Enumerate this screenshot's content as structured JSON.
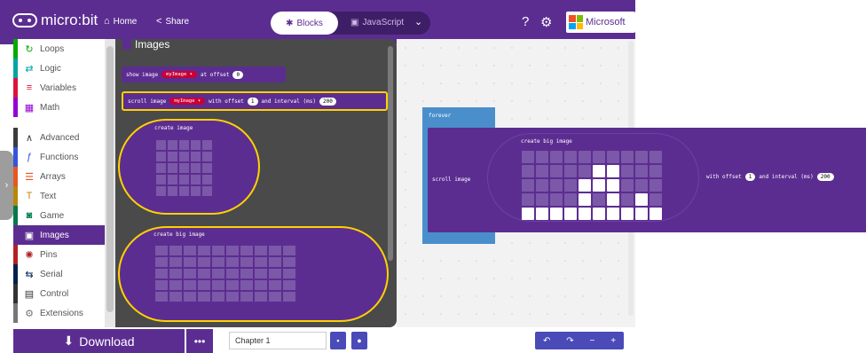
{
  "header": {
    "logo_text": "micro:bit",
    "home_label": "Home",
    "share_label": "Share",
    "blocks_label": "Blocks",
    "javascript_label": "JavaScript",
    "brand_label": "Microsoft",
    "icons": [
      "home-icon",
      "share-icon",
      "help-icon",
      "gear-icon"
    ]
  },
  "toolbox": {
    "categories": [
      {
        "label": "Loops",
        "color": "#00aa00",
        "icon": "loop-icon"
      },
      {
        "label": "Logic",
        "color": "#00a4a6",
        "icon": "logic-icon"
      },
      {
        "label": "Variables",
        "color": "#dc143c",
        "icon": "variables-icon"
      },
      {
        "label": "Math",
        "color": "#9400d3",
        "icon": "math-icon"
      },
      {
        "label": "Advanced",
        "color": "#3c3c3c",
        "icon": "chevron-up-icon"
      },
      {
        "label": "Functions",
        "color": "#3455db",
        "icon": "functions-icon"
      },
      {
        "label": "Arrays",
        "color": "#e65722",
        "icon": "arrays-icon"
      },
      {
        "label": "Text",
        "color": "#b8860b",
        "icon": "text-icon"
      },
      {
        "label": "Game",
        "color": "#007a4b",
        "icon": "game-icon"
      },
      {
        "label": "Images",
        "color": "#5c2d91",
        "icon": "images-icon"
      },
      {
        "label": "Pins",
        "color": "#b22222",
        "icon": "pins-icon"
      },
      {
        "label": "Serial",
        "color": "#002050",
        "icon": "serial-icon"
      },
      {
        "label": "Control",
        "color": "#333333",
        "icon": "control-icon"
      },
      {
        "label": "Extensions",
        "color": "#777777",
        "icon": "extensions-icon"
      }
    ],
    "selected": "Images"
  },
  "flyout": {
    "title": "Images",
    "show_image": {
      "prefix": "show image",
      "var": "myImage ▾",
      "suffix": "at offset",
      "offset": "0"
    },
    "scroll_image": {
      "prefix": "scroll image",
      "var": "myImage ▾",
      "mid": "with offset",
      "offset": "1",
      "interval_label": "and interval (ms)",
      "interval": "200"
    },
    "create_image": "create image",
    "create_big_image": "create big image"
  },
  "workspace": {
    "forever_label": "forever",
    "scroll_label": "scroll image",
    "big_image_label": "create big image",
    "offset_label": "with offset",
    "offset_value": "1",
    "interval_label": "and interval (ms)",
    "interval_value": "200",
    "leds": [
      [
        0,
        0,
        0,
        0,
        0,
        0,
        0,
        0,
        0,
        0
      ],
      [
        0,
        0,
        0,
        0,
        0,
        1,
        1,
        0,
        0,
        0
      ],
      [
        0,
        0,
        0,
        0,
        1,
        1,
        1,
        0,
        0,
        0
      ],
      [
        0,
        0,
        0,
        0,
        1,
        0,
        1,
        0,
        1,
        0
      ],
      [
        1,
        1,
        1,
        1,
        1,
        1,
        1,
        1,
        1,
        1
      ]
    ]
  },
  "footer": {
    "download_label": "Download",
    "more_label": "•••",
    "project_name": "Chapter 1"
  }
}
